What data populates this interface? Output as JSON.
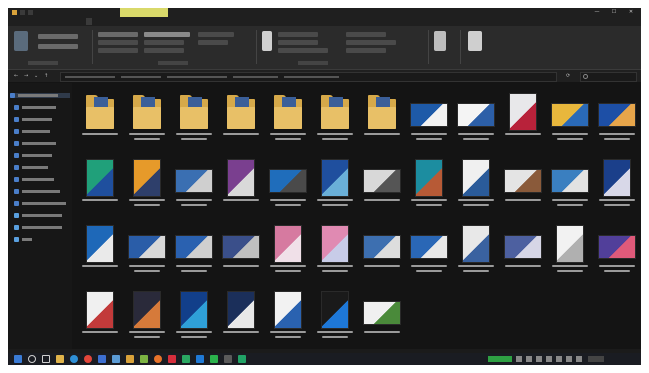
{
  "window": {
    "title": "",
    "controls": {
      "minimize": "—",
      "maximize": "☐",
      "close": "✕"
    }
  },
  "ribbon": {
    "tabs": [
      "",
      "",
      "",
      ""
    ],
    "active_tab_index": 3
  },
  "address": {
    "back": "←",
    "forward": "→",
    "up": "↑",
    "refresh": "⟳",
    "search_placeholder": ""
  },
  "nav_pane": {
    "items": [
      "",
      "",
      "",
      "",
      "",
      "",
      "",
      "",
      "",
      "",
      "",
      "",
      ""
    ]
  },
  "content": {
    "items": [
      {
        "type": "folder",
        "label": ""
      },
      {
        "type": "folder",
        "label": ""
      },
      {
        "type": "folder",
        "label": ""
      },
      {
        "type": "folder",
        "label": ""
      },
      {
        "type": "folder",
        "label": ""
      },
      {
        "type": "folder",
        "label": ""
      },
      {
        "type": "folder",
        "label": ""
      },
      {
        "type": "image",
        "label": "",
        "colors": [
          "#1e5aa8",
          "#f2f2f2"
        ]
      },
      {
        "type": "image",
        "label": "",
        "colors": [
          "#f4f4f4",
          "#2c5fa8"
        ]
      },
      {
        "type": "image",
        "label": "",
        "colors": [
          "#e8e8ea",
          "#b8223a"
        ]
      },
      {
        "type": "image",
        "label": "",
        "colors": [
          "#e8b73c",
          "#2a6ab8"
        ]
      },
      {
        "type": "image",
        "label": "",
        "colors": [
          "#1d4fa6",
          "#e7a54a"
        ]
      },
      {
        "type": "image",
        "label": "",
        "colors": [
          "#20a07a",
          "#1f4f9e"
        ]
      },
      {
        "type": "image",
        "label": "",
        "colors": [
          "#e69a2a",
          "#2e3f6b"
        ]
      },
      {
        "type": "image",
        "label": "",
        "colors": [
          "#3a6fb2",
          "#cfcfcf"
        ]
      },
      {
        "type": "image",
        "label": "",
        "colors": [
          "#7a3f8f",
          "#d9d9d9"
        ]
      },
      {
        "type": "image",
        "label": "",
        "colors": [
          "#1f6dbb",
          "#4a4a4a"
        ]
      },
      {
        "type": "image",
        "label": "",
        "colors": [
          "#1f4f9e",
          "#6ab0d8"
        ]
      },
      {
        "type": "image",
        "label": "",
        "colors": [
          "#d8d8d8",
          "#555555"
        ]
      },
      {
        "type": "image",
        "label": "",
        "colors": [
          "#1c8da0",
          "#b75a36"
        ]
      },
      {
        "type": "image",
        "label": "",
        "colors": [
          "#f0f0f0",
          "#2a5b9a"
        ]
      },
      {
        "type": "image",
        "label": "",
        "colors": [
          "#e4e4e4",
          "#8a5a3a"
        ]
      },
      {
        "type": "image",
        "label": "",
        "colors": [
          "#3a7fc0",
          "#e2e2e2"
        ]
      },
      {
        "type": "image",
        "label": "",
        "colors": [
          "#1b3f8a",
          "#d8d8e8"
        ]
      },
      {
        "type": "image",
        "label": "",
        "colors": [
          "#1e68b8",
          "#eaeaea"
        ]
      },
      {
        "type": "image",
        "label": "",
        "colors": [
          "#2a5da8",
          "#d8d8d8"
        ]
      },
      {
        "type": "image",
        "label": "",
        "colors": [
          "#2a61b0",
          "#cfcfcf"
        ]
      },
      {
        "type": "image",
        "label": "",
        "colors": [
          "#3a4f8a",
          "#c0c0c0"
        ]
      },
      {
        "type": "image",
        "label": "",
        "colors": [
          "#d67aa0",
          "#f0e0e8"
        ]
      },
      {
        "type": "image",
        "label": "",
        "colors": [
          "#e08ab2",
          "#c8cce8"
        ]
      },
      {
        "type": "image",
        "label": "",
        "colors": [
          "#3d6fb0",
          "#dddddd"
        ]
      },
      {
        "type": "image",
        "label": "",
        "colors": [
          "#2a67b6",
          "#e8e8e8"
        ]
      },
      {
        "type": "image",
        "label": "",
        "colors": [
          "#e8e8e8",
          "#3a62a0"
        ]
      },
      {
        "type": "image",
        "label": "",
        "colors": [
          "#4d60a0",
          "#d6d6e6"
        ]
      },
      {
        "type": "image",
        "label": "",
        "colors": [
          "#f2f2f2",
          "#b0b0b0"
        ]
      },
      {
        "type": "image",
        "label": "",
        "colors": [
          "#513f9a",
          "#e05a7a"
        ]
      },
      {
        "type": "image",
        "label": "",
        "colors": [
          "#f0f0f0",
          "#c23a3a"
        ]
      },
      {
        "type": "image",
        "label": "",
        "colors": [
          "#2a2a3a",
          "#d67a3a"
        ]
      },
      {
        "type": "image",
        "label": "",
        "colors": [
          "#123f8a",
          "#2fa0d8"
        ]
      },
      {
        "type": "image",
        "label": "",
        "colors": [
          "#1b2f5a",
          "#e8e8e8"
        ]
      },
      {
        "type": "image",
        "label": "",
        "colors": [
          "#f2f2f2",
          "#2a62b0"
        ]
      },
      {
        "type": "image",
        "label": "",
        "colors": [
          "#1a1a1a",
          "#1e78d8"
        ]
      },
      {
        "type": "image",
        "label": "",
        "colors": [
          "#f0f0f0",
          "#4a8a3a"
        ]
      }
    ]
  },
  "status": {
    "text": ""
  },
  "taskbar": {
    "apps": [
      {
        "icon": "start-icon",
        "color": "#3a7bd5"
      },
      {
        "icon": "search-icon",
        "color": "#cfcfcf"
      },
      {
        "icon": "task-view-icon",
        "color": "#cfcfcf"
      },
      {
        "icon": "file-explorer-icon",
        "color": "#e0b34a"
      },
      {
        "icon": "edge-icon",
        "color": "#2e8fd6"
      },
      {
        "icon": "chrome-icon",
        "color": "#e3463a"
      },
      {
        "icon": "store-icon",
        "color": "#3d6fd1"
      },
      {
        "icon": "mail-icon",
        "color": "#5b9bd5"
      },
      {
        "icon": "photos-icon",
        "color": "#d9a23a"
      },
      {
        "icon": "chrome-alt-icon",
        "color": "#7cb342"
      },
      {
        "icon": "firefox-icon",
        "color": "#e8732a"
      },
      {
        "icon": "app-red-icon",
        "color": "#d62e3c"
      },
      {
        "icon": "phone-icon",
        "color": "#2aa862"
      },
      {
        "icon": "app-blue-icon",
        "color": "#1f7ad6"
      },
      {
        "icon": "whatsapp-icon",
        "color": "#2bb24c"
      },
      {
        "icon": "app-dark-icon",
        "color": "#5a5a5a"
      },
      {
        "icon": "app-green-icon",
        "color": "#21a366"
      }
    ],
    "clock_time": "",
    "clock_date": ""
  }
}
